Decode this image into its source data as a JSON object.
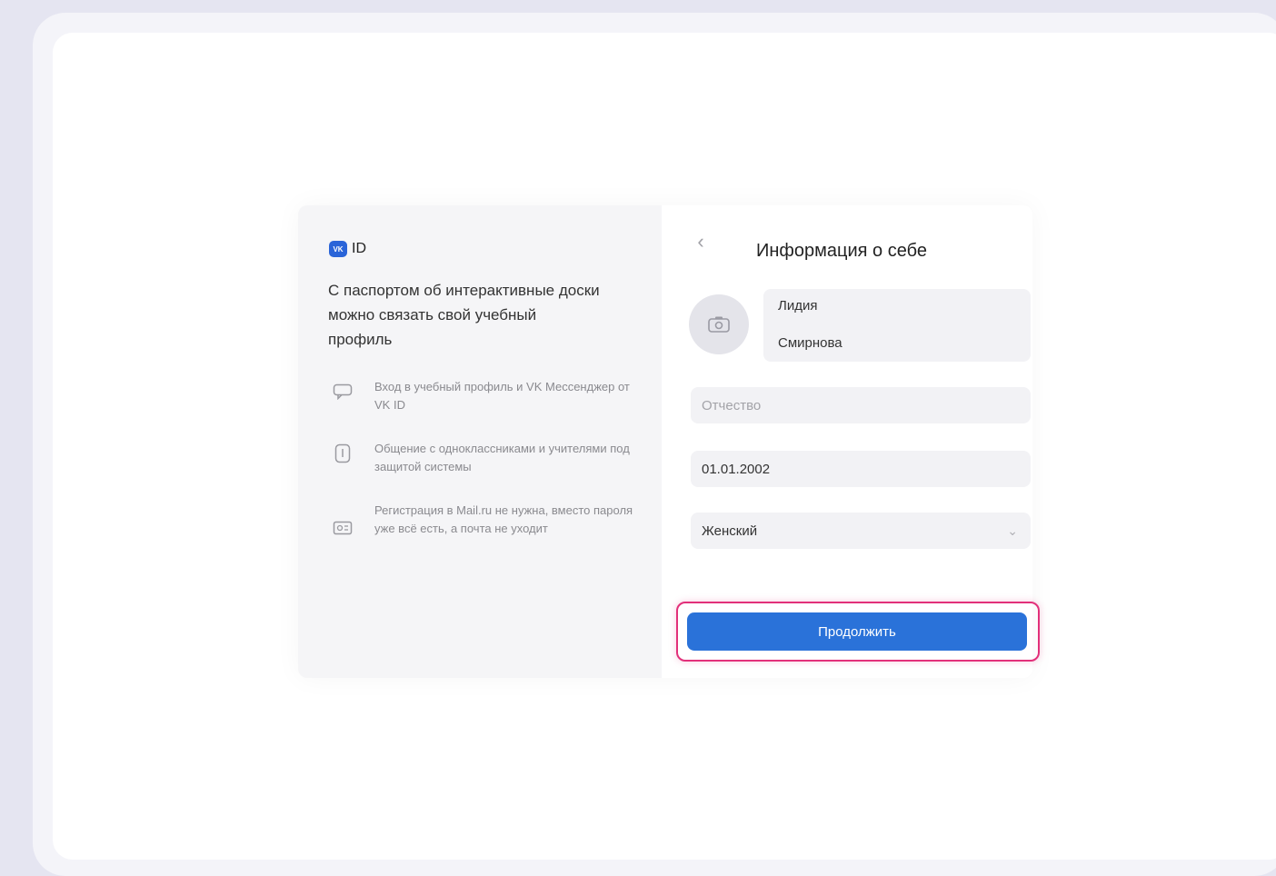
{
  "brand": {
    "logo_text": "ID",
    "logo_badge": "VK"
  },
  "left_panel": {
    "intro": "С паспортом об интерактивные доски можно связать свой учебный профиль",
    "features": [
      {
        "icon": "chat-icon",
        "text": "Вход в учебный профиль и VK Мессенджер от VK ID"
      },
      {
        "icon": "shield-icon",
        "text": "Общение с одноклассниками и учителями под защитой системы"
      },
      {
        "icon": "id-card-icon",
        "text": "Регистрация в Mail.ru не нужна, вместо пароля уже всё есть, а почта не уходит"
      }
    ]
  },
  "form": {
    "title": "Информация о себе",
    "first_name": "Лидия",
    "last_name": "Смирнова",
    "patronymic_placeholder": "Отчество",
    "birth_date": "01.01.2002",
    "gender": "Женский",
    "continue_label": "Продолжить"
  },
  "colors": {
    "accent": "#2a72d9",
    "highlight": "#e2307a"
  }
}
